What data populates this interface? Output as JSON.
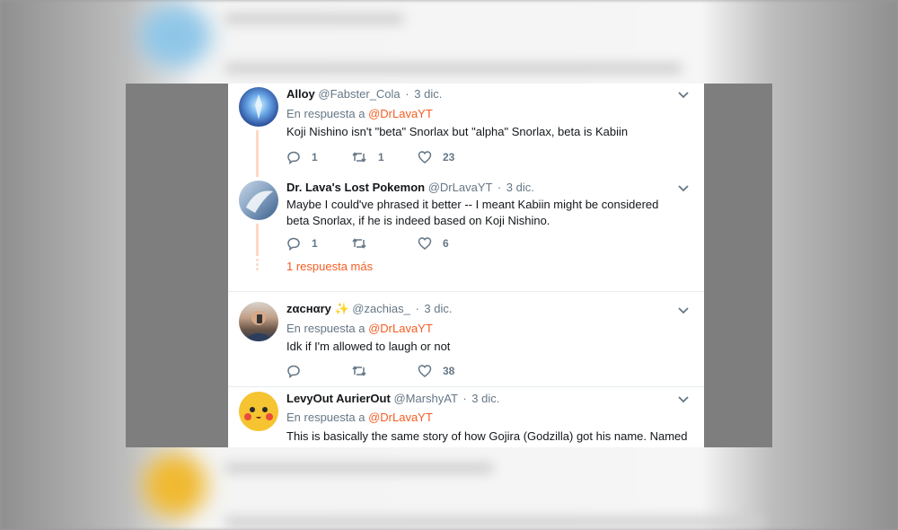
{
  "colors": {
    "accent": "#f45d22",
    "text": "#14171a",
    "muted": "#657786"
  },
  "tweets": [
    {
      "display_name": "Alloy",
      "handle": "@Fabster_Cola",
      "date": "3 dic.",
      "reply_prefix": "En respuesta a",
      "reply_to": "@DrLavaYT",
      "text": "Koji Nishino isn't \"beta\" Snorlax but \"alpha\" Snorlax, beta is Kabiin",
      "replies": "1",
      "retweets": "1",
      "likes": "23"
    },
    {
      "display_name": "Dr. Lava's Lost Pokemon",
      "handle": "@DrLavaYT",
      "date": "3 dic.",
      "text": "Maybe I could've phrased it better -- I meant Kabiin might be considered beta Snorlax, if he is indeed based on Koji Nishino.",
      "replies": "1",
      "retweets": "",
      "likes": "6",
      "more_replies": "1 respuesta más"
    },
    {
      "display_name": "zαcнαry",
      "badge": "✨",
      "handle": "@zachias_",
      "date": "3 dic.",
      "reply_prefix": "En respuesta a",
      "reply_to": "@DrLavaYT",
      "text": "Idk if I'm allowed to laugh or not",
      "replies": "",
      "retweets": "",
      "likes": "38"
    },
    {
      "display_name": "LevyOut AurierOut",
      "handle": "@MarshyAT",
      "date": "3 dic.",
      "reply_prefix": "En respuesta a",
      "reply_to": "@DrLavaYT",
      "text": "This is basically the same story of how Gojira (Godzilla) got his name. Named"
    }
  ]
}
